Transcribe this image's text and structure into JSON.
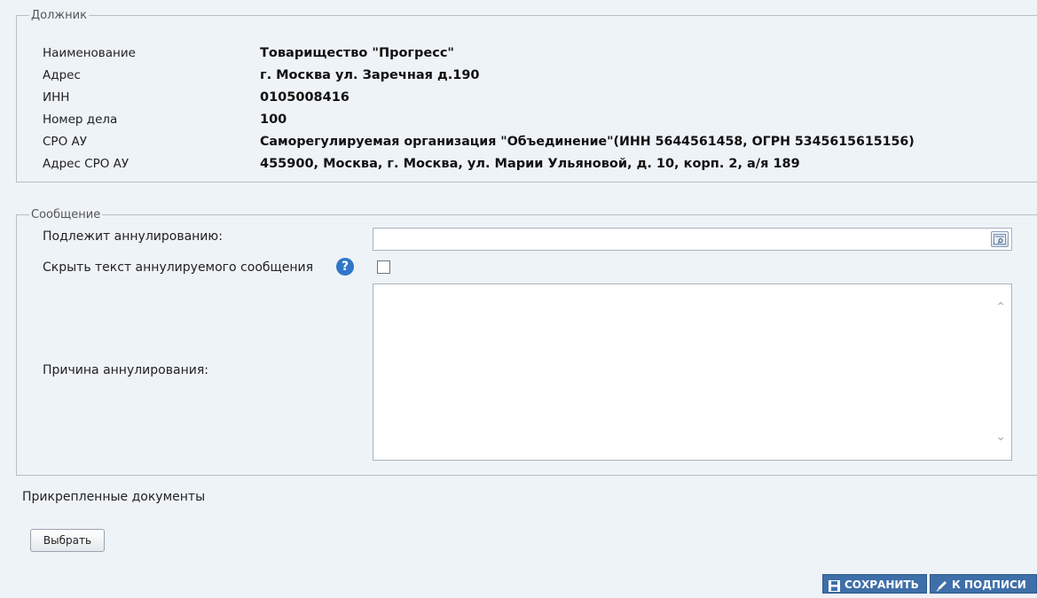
{
  "debtor": {
    "legend": "Должник",
    "rows": [
      {
        "label": "Наименование",
        "value": "Товарищество \"Прогресс\""
      },
      {
        "label": "Адрес",
        "value": "г. Москва ул. Заречная д.190"
      },
      {
        "label": "ИНН",
        "value": "0105008416"
      },
      {
        "label": "Номер дела",
        "value": "100"
      },
      {
        "label": "СРО АУ",
        "value": "Саморегулируемая организация \"Объединение\"(ИНН 5644561458, ОГРН 5345615615156)"
      },
      {
        "label": "Адрес СРО АУ",
        "value": "455900, Москва, г. Москва, ул. Марии Ульяновой, д. 10, корп. 2, а/я 189"
      }
    ]
  },
  "message": {
    "legend": "Сообщение",
    "cancel_label": "Подлежит аннулированию:",
    "cancel_value": "",
    "hide_label": "Скрыть текст аннулируемого сообщения",
    "hide_checked": false,
    "reason_label": "Причина аннулирования:",
    "reason_value": ""
  },
  "attachments": {
    "label": "Прикрепленные документы",
    "choose_button": "Выбрать"
  },
  "actions": {
    "save_label": "СОХРАНИТЬ",
    "sign_label": "К ПОДПИСИ"
  },
  "icons": {
    "lookup": "lookup-icon",
    "help": "help-icon",
    "save": "floppy-disk-icon",
    "sign": "pen-icon"
  },
  "colors": {
    "page_bg": "#eef3f8",
    "action_button_bg": "#3e6fa8",
    "help_icon": "#2f77c8"
  }
}
